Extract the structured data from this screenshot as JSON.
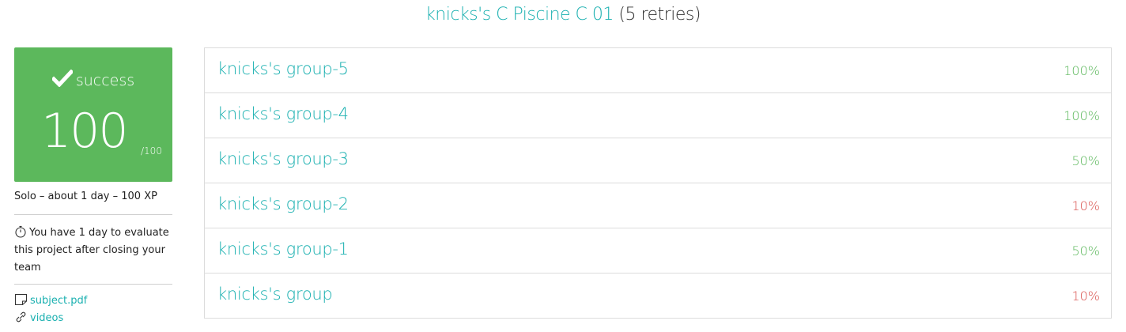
{
  "header": {
    "project_title": "knicks's C Piscine C 01",
    "retries": "(5 retries)"
  },
  "score": {
    "status": "success",
    "value": "100",
    "max": "/100",
    "color": "#5cb85c"
  },
  "info": {
    "meta": "Solo – about 1 day – 100 XP",
    "evaluation_note": "You have 1 day to evaluate this project after closing your team",
    "links": {
      "subject": "subject.pdf",
      "videos": "videos"
    }
  },
  "teams": [
    {
      "name": "knicks's group-5",
      "score": "100%",
      "color": "#5cb85c"
    },
    {
      "name": "knicks's group-4",
      "score": "100%",
      "color": "#5cb85c"
    },
    {
      "name": "knicks's group-3",
      "score": "50%",
      "color": "#5cb85c"
    },
    {
      "name": "knicks's group-2",
      "score": "10%",
      "color": "#d9534f"
    },
    {
      "name": "knicks's group-1",
      "score": "50%",
      "color": "#5cb85c"
    },
    {
      "name": "knicks's group",
      "score": "10%",
      "color": "#d9534f"
    }
  ],
  "icons": {
    "status": "check-icon",
    "timer": "stopwatch-icon",
    "subject": "file-icon",
    "videos": "link-icon"
  },
  "colors": {
    "accent": "#1ab0b0",
    "success": "#5cb85c",
    "fail": "#d9534f"
  }
}
